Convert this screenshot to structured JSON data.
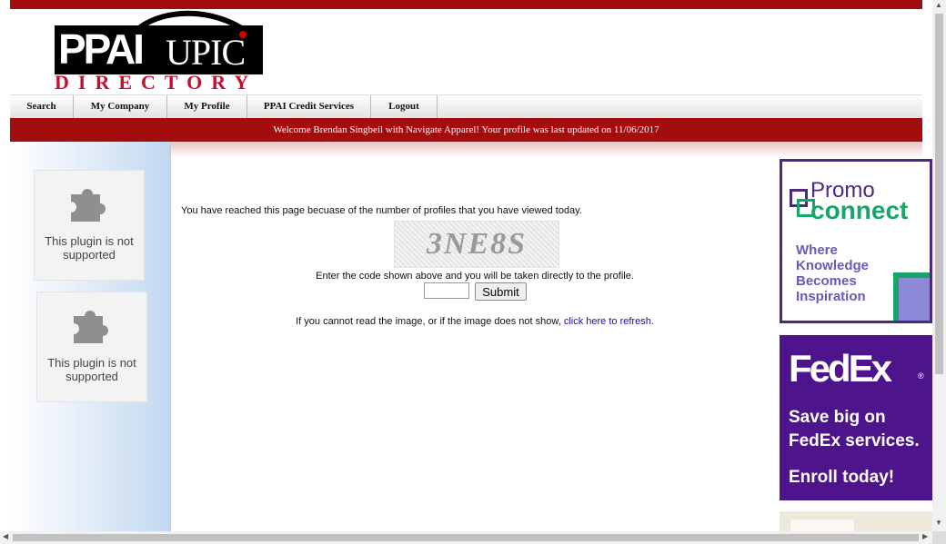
{
  "logo": {
    "ppai": "PPAI",
    "upic": "UPIC",
    "directory": "DIRECTORY"
  },
  "nav": [
    {
      "label": "Search"
    },
    {
      "label": "My Company"
    },
    {
      "label": "My Profile"
    },
    {
      "label": "PPAI Credit Services"
    },
    {
      "label": "Logout"
    }
  ],
  "welcome": "Welcome Brendan Singbeil with Navigate Apparel! Your profile was last updated on 11/06/2017",
  "plugins": [
    {
      "icon": "puzzle-piece-icon",
      "text": "This plugin is not supported"
    },
    {
      "icon": "puzzle-piece-icon",
      "text": "This plugin is not supported"
    }
  ],
  "main": {
    "message": "You have reached this page becuase of the number of profiles that you have viewed today.",
    "captcha_text": "3NE8S",
    "instruction": "Enter the code shown above and you will be taken directly to the profile.",
    "code_value": "",
    "submit_label": "Submit",
    "refresh_prefix": "If you cannot read the image, or if the image does not show, ",
    "refresh_link": "click here to refresh",
    "refresh_suffix": "."
  },
  "ads": {
    "promo": {
      "line1": "Promo",
      "line2": "connect",
      "tagline": [
        "Where",
        "Knowledge",
        "Becomes",
        "Inspiration"
      ]
    },
    "fedex": {
      "logo": "FedEx",
      "mark": "®",
      "line1": "Save big on",
      "line2": "FedEx services.",
      "line3": "Enroll today!"
    }
  },
  "colors": {
    "brand_red": "#a30d0d",
    "fedex_purple": "#4d148c",
    "promo_green": "#17a56a",
    "link": "#1a0dab"
  }
}
